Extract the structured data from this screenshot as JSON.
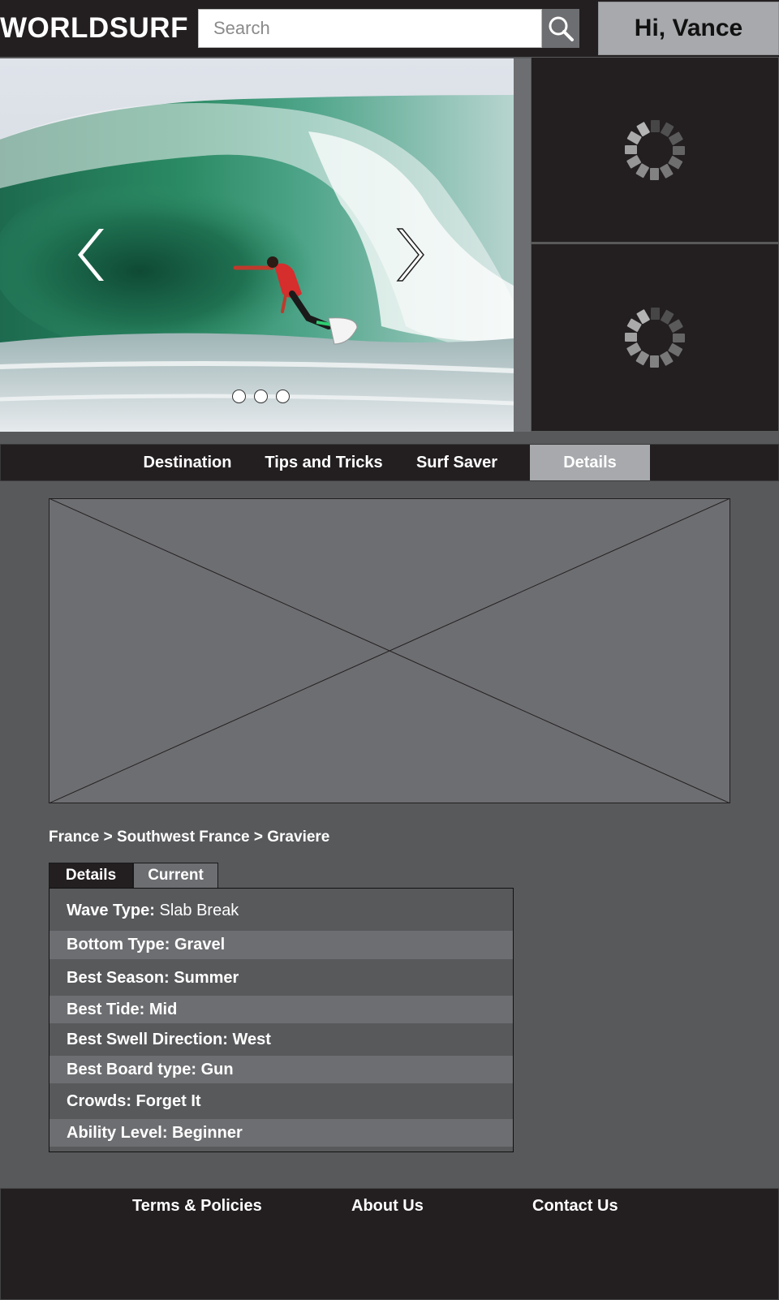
{
  "header": {
    "logo": "WORLDSURF",
    "search_placeholder": "Search",
    "search_icon": "magnifier-icon",
    "greeting": "Hi, Vance"
  },
  "hero": {
    "image": "surfer-barrel-wave-photo",
    "prev_icon": "chevron-left-icon",
    "next_icon": "chevron-right-icon",
    "slide_count": 3
  },
  "side_panels": [
    {
      "icon": "loading-spinner-icon"
    },
    {
      "icon": "loading-spinner-icon"
    }
  ],
  "nav": {
    "items": [
      "Destination",
      "Tips and Tricks",
      "Surf Saver",
      "Details"
    ],
    "active": "Details"
  },
  "main": {
    "image_placeholder": "image-placeholder",
    "breadcrumb": "France > Southwest France > Graviere",
    "tabs": [
      "Details",
      "Current"
    ],
    "active_tab": "Details",
    "details": [
      {
        "label": "Wave Type:",
        "value": " Slab Break"
      },
      {
        "label": "Bottom Type:",
        "value": " Gravel"
      },
      {
        "label": "Best Season:",
        "value": " Summer"
      },
      {
        "label": "Best Tide:",
        "value": " Mid"
      },
      {
        "label": "Best Swell Direction:",
        "value": " West"
      },
      {
        "label": "Best Board type:",
        "value": " Gun"
      },
      {
        "label": "Crowds:",
        "value": " Forget It"
      },
      {
        "label": "Ability Level:",
        "value": " Beginner"
      }
    ]
  },
  "footer": {
    "links": [
      "Terms & Policies",
      "About Us",
      "Contact Us"
    ]
  },
  "colors": {
    "dark": "#231f20",
    "mid_gray": "#58595b",
    "light_gray": "#6d6e71",
    "accent_gray": "#a7a9ac",
    "text": "#ffffff"
  }
}
